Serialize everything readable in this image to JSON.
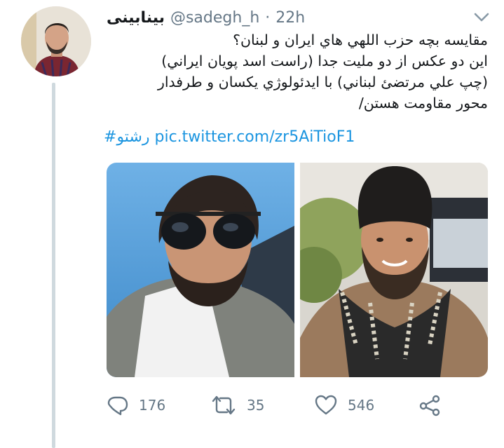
{
  "tweet": {
    "display_name": "بینابینی",
    "handle": "@sadegh_h",
    "separator": "·",
    "time": "22h",
    "text_lines": [
      "مقایسه بچه حزب اللهي هاي ايران و لبنان؟",
      "اين دو عكس از دو مليت جدا (راست اسد پويان ايراني)",
      "(چپ علي مرتضئ لبناني) با ايدئولوژي يكسان و طرفدار",
      "محور مقاومت هستن/"
    ],
    "hashtag": "#رشتو",
    "link": "pic.twitter.com/zr5AiTioF1"
  },
  "actions": {
    "reply_count": "176",
    "retweet_count": "35",
    "like_count": "546"
  },
  "colors": {
    "link": "#1b95e0",
    "muted": "#657786",
    "thread_line": "#cfd9de"
  },
  "icons": [
    "chevron-down-icon",
    "reply-icon",
    "retweet-icon",
    "like-icon",
    "share-icon"
  ]
}
